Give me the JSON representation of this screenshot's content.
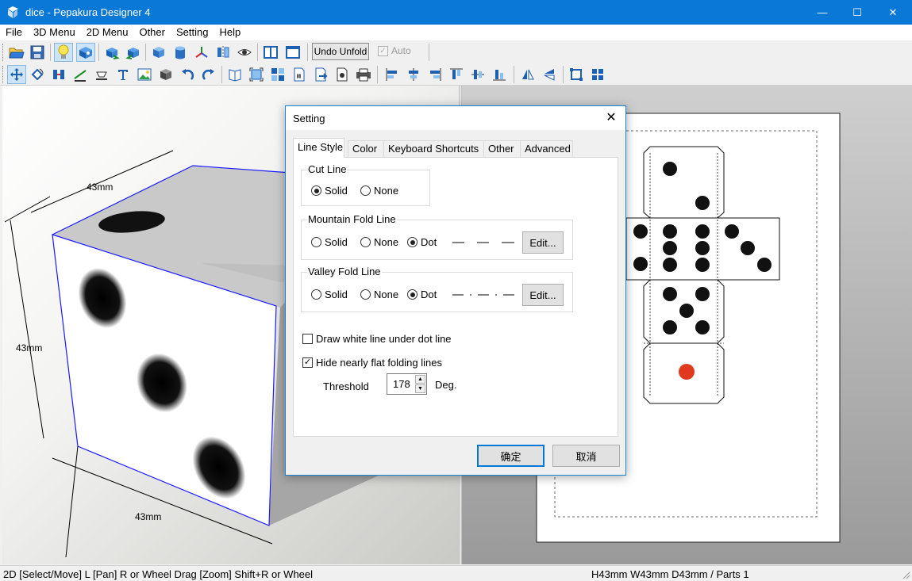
{
  "window": {
    "title": "dice - Pepakura Designer 4",
    "minimize_glyph": "—",
    "maximize_glyph": "☐",
    "close_glyph": "✕"
  },
  "menu": [
    "File",
    "3D Menu",
    "2D Menu",
    "Other",
    "Setting",
    "Help"
  ],
  "toolbar1": {
    "icons": [
      "open-icon",
      "save-icon",
      "light-bulb-icon",
      "texture-icon",
      "rotate-left-icon",
      "rotate-right-icon",
      "cube-icon",
      "cylinder-icon",
      "axis-icon",
      "flip-icon",
      "eye-icon",
      "split-view-icon",
      "single-view-icon"
    ],
    "undo_unfold_label": "Undo Unfold",
    "auto_label": "Auto",
    "auto_checked": true,
    "auto_enabled": false
  },
  "toolbar2": {
    "icons": [
      "select-move-icon",
      "rotate-part-icon",
      "join-icon",
      "fold-line-icon",
      "flap-icon",
      "text-icon",
      "image-icon",
      "box-icon",
      "undo-icon",
      "redo-icon",
      "book-icon",
      "fit-icon",
      "grid-icon",
      "page-number-icon",
      "export-icon",
      "print-preview-icon",
      "print-icon",
      "align-left-icon",
      "align-center-h-icon",
      "align-right-icon",
      "align-top-icon",
      "align-middle-icon",
      "align-bottom-icon",
      "flip-h-icon",
      "flip-v-icon",
      "arrange-icon",
      "distribute-icon"
    ]
  },
  "view3d": {
    "dimension_top": "43mm",
    "dimension_left": "43mm",
    "dimension_bottom": "43mm",
    "edge_color": "#1a1aff",
    "pip_color": "#111111"
  },
  "view2d": {
    "pip_color": "#111111",
    "accent_pip_color": "#e03a1e"
  },
  "status": {
    "left": "2D [Select/Move] L [Pan] R or Wheel Drag [Zoom] Shift+R or Wheel",
    "right": "H43mm W43mm D43mm / Parts 1"
  },
  "dialog": {
    "title": "Setting",
    "close_glyph": "✕",
    "tabs": [
      "Line Style",
      "Color",
      "Keyboard Shortcuts",
      "Other",
      "Advanced"
    ],
    "active_tab": "Line Style",
    "cut_line": {
      "label": "Cut Line",
      "options": [
        "Solid",
        "None"
      ],
      "selected": "Solid"
    },
    "mountain_fold": {
      "label": "Mountain Fold Line",
      "options": [
        "Solid",
        "None",
        "Dot"
      ],
      "selected": "Dot",
      "edit_label": "Edit..."
    },
    "valley_fold": {
      "label": "Valley Fold Line",
      "options": [
        "Solid",
        "None",
        "Dot"
      ],
      "selected": "Dot",
      "edit_label": "Edit..."
    },
    "draw_white_line": {
      "label": "Draw white line under dot line",
      "checked": false
    },
    "hide_flat": {
      "label": "Hide nearly flat folding lines",
      "checked": true
    },
    "threshold": {
      "label": "Threshold",
      "value": "178",
      "unit": "Deg."
    },
    "ok_label": "确定",
    "cancel_label": "取消"
  }
}
